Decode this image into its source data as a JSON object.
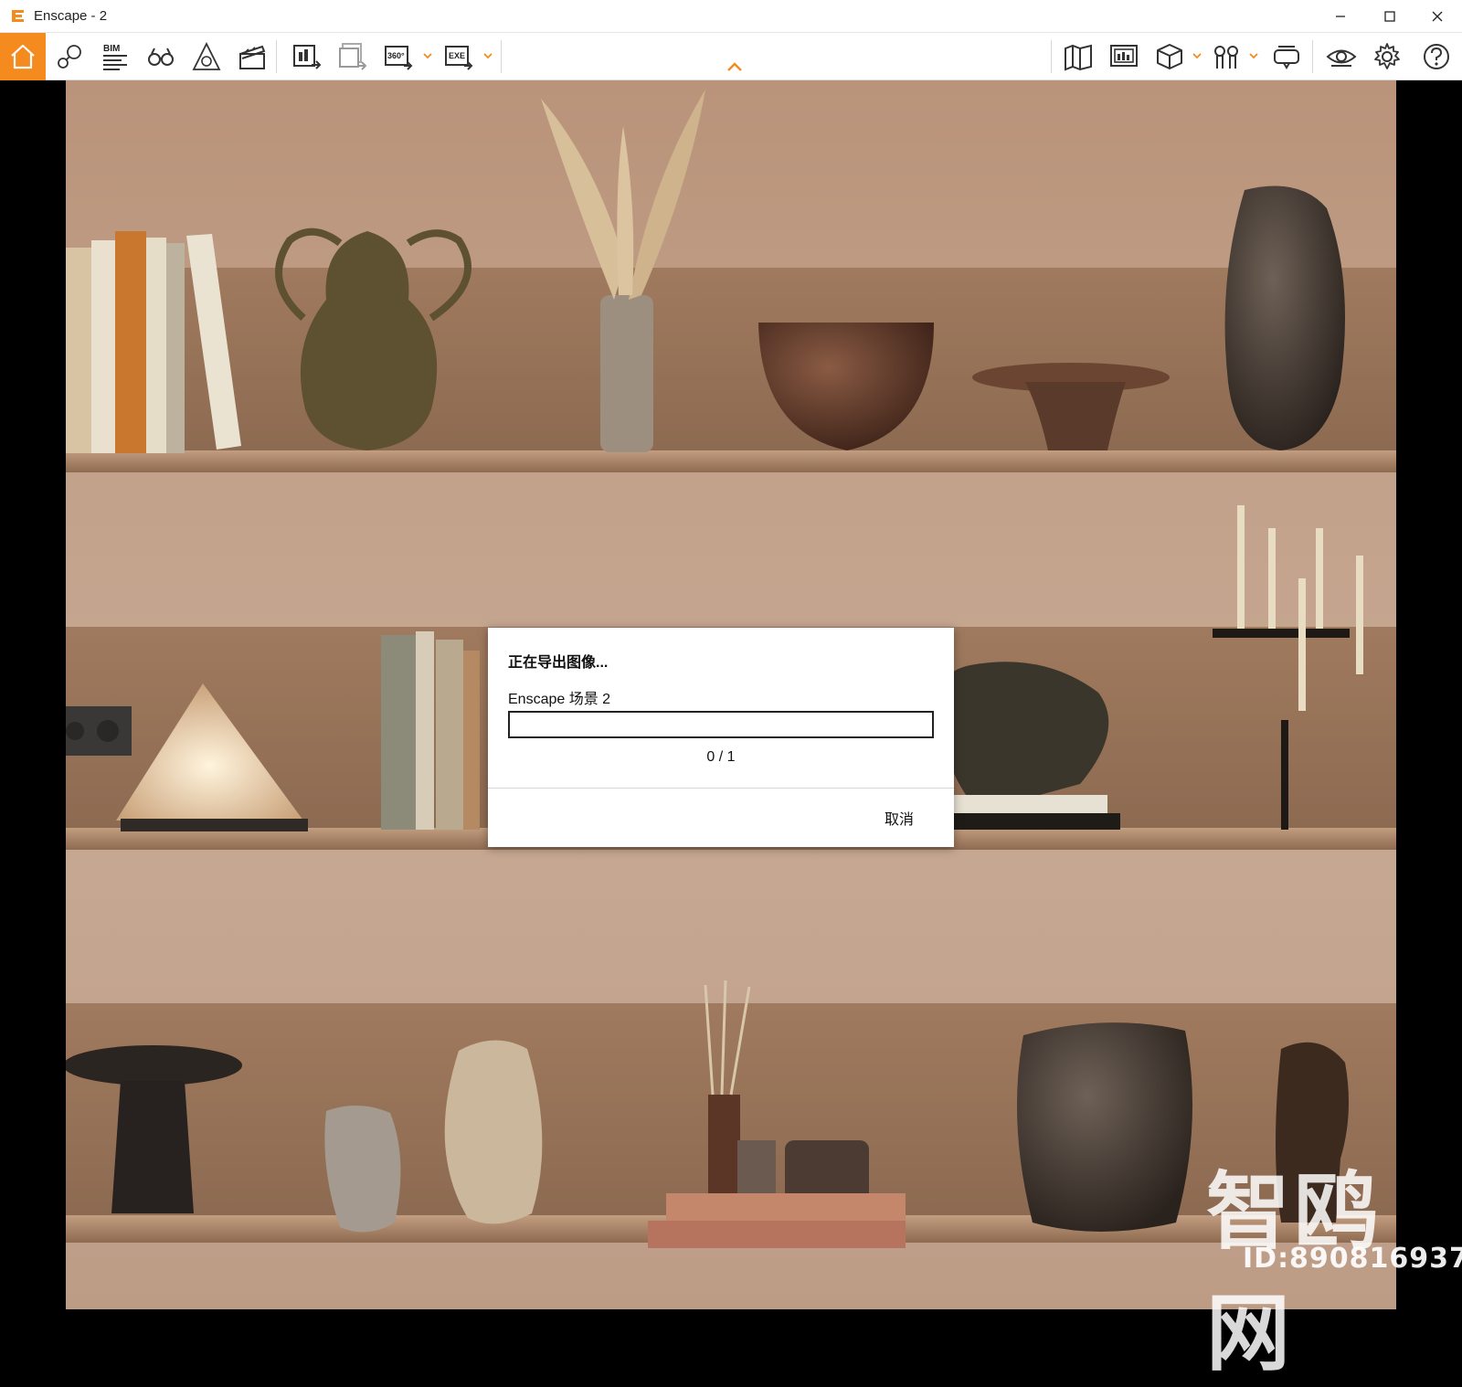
{
  "window": {
    "title": "Enscape - 2",
    "controls": [
      "minimize",
      "maximize",
      "close"
    ]
  },
  "toolbar": {
    "left_buttons": [
      {
        "icon": "home-icon",
        "active": true
      },
      {
        "icon": "map-pin-icon"
      },
      {
        "icon": "bim-icon",
        "label": "BIM"
      },
      {
        "icon": "binoculars-icon"
      },
      {
        "icon": "perspective-icon"
      },
      {
        "icon": "clapperboard-icon"
      },
      {
        "icon": "render-export-icon"
      },
      {
        "icon": "batch-export-icon"
      },
      {
        "icon": "panorama-export-icon",
        "label": "360°"
      },
      {
        "icon": "exe-export-icon",
        "label": "EXE"
      }
    ],
    "right_buttons": [
      {
        "icon": "map-view-icon"
      },
      {
        "icon": "cinema-icon"
      },
      {
        "icon": "cube-icon"
      },
      {
        "icon": "asset-library-icon"
      },
      {
        "icon": "vr-headset-icon"
      },
      {
        "icon": "eye-icon"
      },
      {
        "icon": "settings-icon"
      },
      {
        "icon": "help-icon"
      }
    ],
    "accent_color": "#f58a1f"
  },
  "dialog": {
    "title": "正在导出图像...",
    "scene_label": "Enscape 场景 2",
    "progress": 0,
    "count": "0 / 1",
    "cancel_label": "取消"
  },
  "watermark": {
    "logo_text": "智鸥网",
    "id_text": "ID:890816937"
  }
}
